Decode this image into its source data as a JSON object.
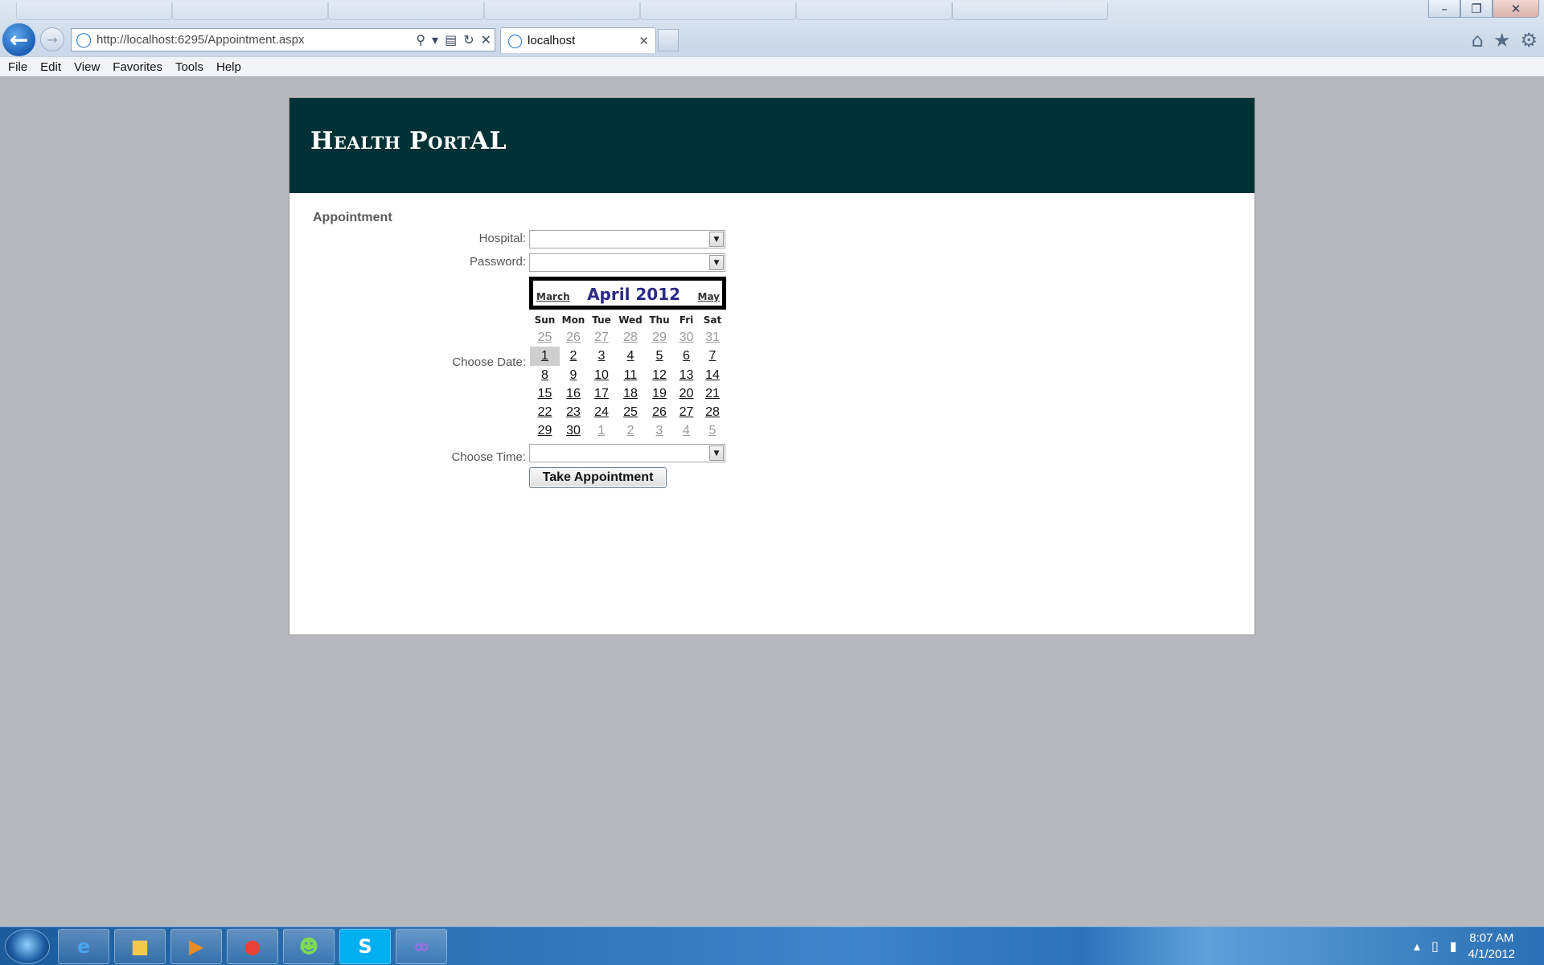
{
  "browser": {
    "url": "http://localhost:6295/Appointment.aspx",
    "tab_title": "localhost",
    "menu": [
      "File",
      "Edit",
      "View",
      "Favorites",
      "Tools",
      "Help"
    ]
  },
  "page": {
    "site_title": "Health PortAL",
    "section_title": "Appointment",
    "form": {
      "hospital_label": "Hospital:",
      "hospital_value": "",
      "password_label": "Password:",
      "password_value": "",
      "date_label": "Choose Date:",
      "time_label": "Choose Time:",
      "time_value": "",
      "submit_label": "Take Appointment"
    },
    "calendar": {
      "title": "April 2012",
      "prev_label": "March",
      "next_label": "May",
      "days_of_week": [
        "Sun",
        "Mon",
        "Tue",
        "Wed",
        "Thu",
        "Fri",
        "Sat"
      ],
      "weeks": [
        [
          "25",
          "26",
          "27",
          "28",
          "29",
          "30",
          "31"
        ],
        [
          "1",
          "2",
          "3",
          "4",
          "5",
          "6",
          "7"
        ],
        [
          "8",
          "9",
          "10",
          "11",
          "12",
          "13",
          "14"
        ],
        [
          "15",
          "16",
          "17",
          "18",
          "19",
          "20",
          "21"
        ],
        [
          "22",
          "23",
          "24",
          "25",
          "26",
          "27",
          "28"
        ],
        [
          "29",
          "30",
          "1",
          "2",
          "3",
          "4",
          "5"
        ]
      ],
      "other_month": [
        [
          true,
          true,
          true,
          true,
          true,
          true,
          true
        ],
        [
          false,
          false,
          false,
          false,
          false,
          false,
          false
        ],
        [
          false,
          false,
          false,
          false,
          false,
          false,
          false
        ],
        [
          false,
          false,
          false,
          false,
          false,
          false,
          false
        ],
        [
          false,
          false,
          false,
          false,
          false,
          false,
          false
        ],
        [
          false,
          false,
          true,
          true,
          true,
          true,
          true
        ]
      ],
      "selected": "1"
    }
  },
  "taskbar": {
    "clock_time": "8:07 AM",
    "clock_date": "4/1/2012",
    "apps": [
      "internet-explorer",
      "file-explorer",
      "media-player",
      "chrome",
      "messenger",
      "skype",
      "visual-studio"
    ]
  }
}
